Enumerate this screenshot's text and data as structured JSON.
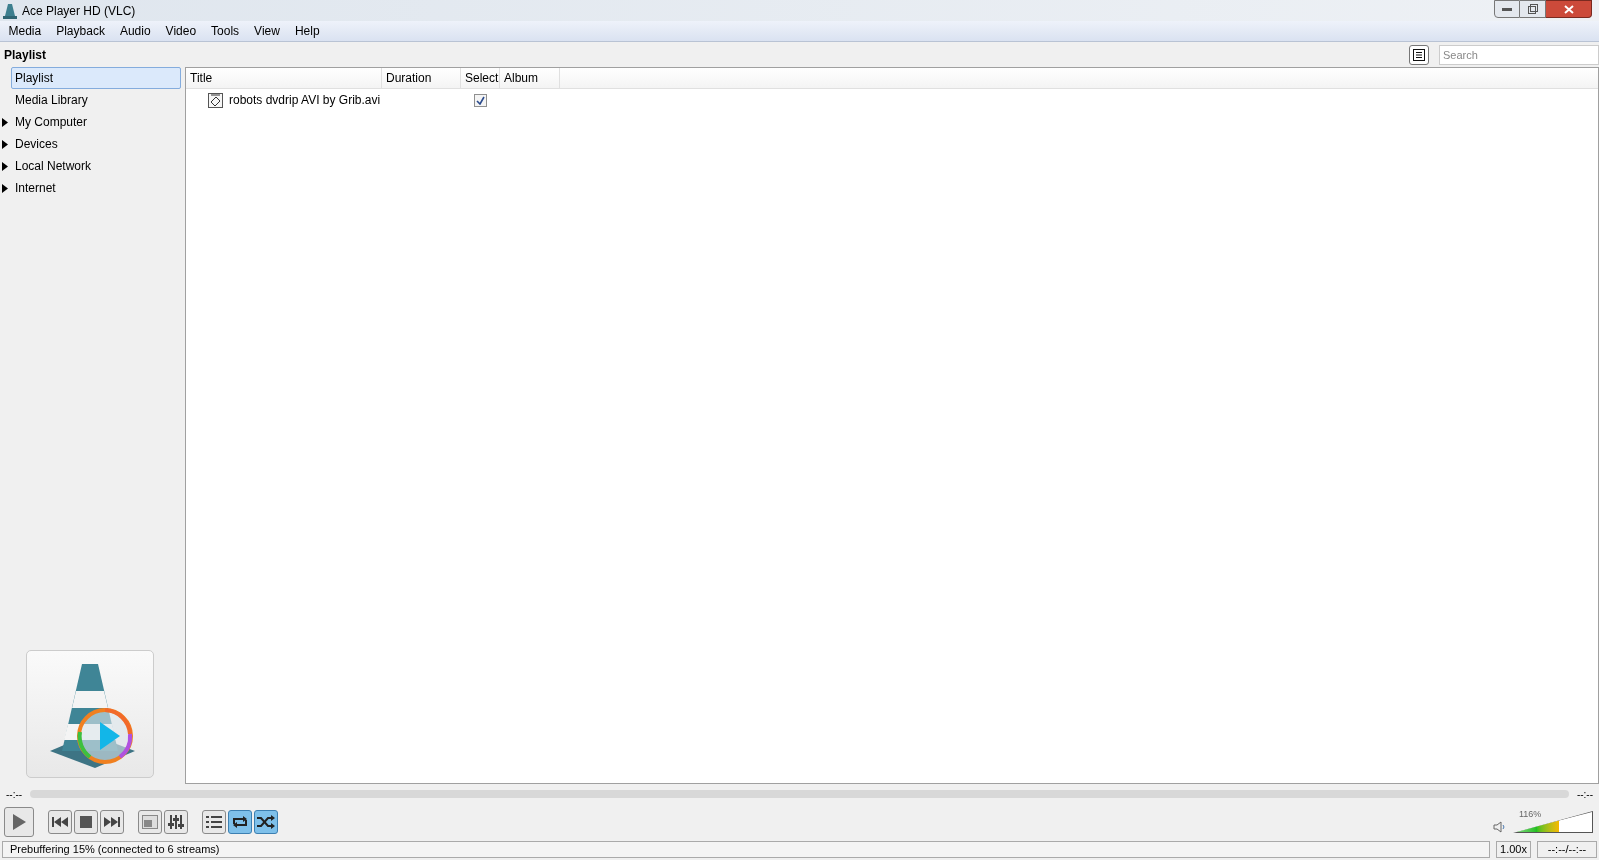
{
  "window": {
    "title": "Ace Player HD (VLC)"
  },
  "menu": [
    "Media",
    "Playback",
    "Audio",
    "Video",
    "Tools",
    "View",
    "Help"
  ],
  "sidebar": {
    "title": "Playlist",
    "items": [
      {
        "label": "Playlist",
        "kind": "leaf",
        "selected": true
      },
      {
        "label": "Media Library",
        "kind": "leaf",
        "selected": false
      },
      {
        "label": "My Computer",
        "kind": "folder",
        "expanded": false,
        "selected": false
      },
      {
        "label": "Devices",
        "kind": "folder",
        "expanded": false,
        "selected": false
      },
      {
        "label": "Local Network",
        "kind": "folder",
        "expanded": false,
        "selected": false
      },
      {
        "label": "Internet",
        "kind": "folder",
        "expanded": false,
        "selected": false
      }
    ]
  },
  "search": {
    "placeholder": "Search"
  },
  "table": {
    "columns": [
      "Title",
      "Duration",
      "Select",
      "Album"
    ],
    "rows": [
      {
        "title": "robots dvdrip AVI by Grib.avi",
        "checked": true
      }
    ]
  },
  "seek": {
    "elapsed": "--:--",
    "total": "--:--"
  },
  "controls": [
    {
      "kind": "play",
      "on": false
    },
    {
      "kind": "prev",
      "on": false
    },
    {
      "kind": "stop",
      "on": false
    },
    {
      "kind": "next",
      "on": false
    },
    {
      "kind": "fullscreen",
      "on": false
    },
    {
      "kind": "extended",
      "on": false
    },
    {
      "kind": "playlist",
      "on": false
    },
    {
      "kind": "loop",
      "on": true
    },
    {
      "kind": "random",
      "on": true
    }
  ],
  "volume": {
    "reading": "116%",
    "level": 0.58
  },
  "status_bar": {
    "message": "Prebuffering 15% (connected to 6 streams)",
    "speed": "1.00x",
    "time": "--:--/--:--"
  }
}
